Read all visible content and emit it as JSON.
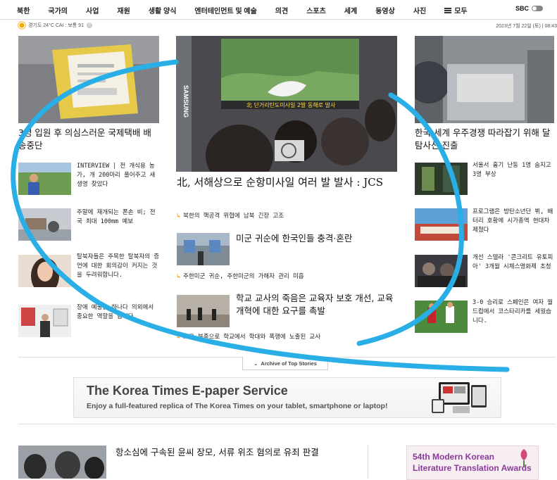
{
  "nav": {
    "items": [
      "북한",
      "국가의",
      "사업",
      "재원",
      "생활 양식",
      "엔터테인먼트 및 예술",
      "의견",
      "스포츠",
      "세계",
      "동영상",
      "사진"
    ],
    "all_label": "모두",
    "sbc_label": "SBC"
  },
  "weather": {
    "text": "경기도 24°C CAI : 보통 91",
    "icon": "sun-icon"
  },
  "date": "2023년 7월 22일 (토) | 08:43",
  "left": {
    "main_headline": "3명 입원 후 의심스러운 국제택배 배송중단",
    "items": [
      "INTERVIEW | 전 개식용 농가, 개 200마리 풀어주고 새 생명 찾았다",
      "주말에 재개되는 폰손 비; 전국 최대 100mm 예보",
      "탈북자들은 주목한 탈북자의 증언에 대한 회의감이 커지는 것을 두려워합니다.",
      "장애 예술을 하나다 의외에서 중요한 역할을 합니다."
    ]
  },
  "center": {
    "lead_headline": "北, 서해상으로 순항미사일 여러 발 발사 : JCS",
    "lead_sub": "북한의 핵공격 위협에 남북 긴장 고조",
    "story2_headline": "미군 귀순에 한국인들 충격·혼란",
    "story2_sub": "주한미군 귀순, 주한미군의 가해자 관리 미흡",
    "story3_headline": "학교 교사의 죽음은 교육자 보호 개선, 교육 개혁에 대한 요구를 촉발",
    "story3_sub": "교육 부족으로 학교에서 학대와 폭행에 노출된 교사",
    "tv_caption": "北 단거리탄도미사일 2발 동해로 발사",
    "samsung": "SAMSUNG"
  },
  "right": {
    "main_headline": "한국 세계 우주경쟁 따라잡기 위해 달 탐사선 진출",
    "items": [
      "서울서 흉기 난동 1명 숨지고 3명 부상",
      "프로그램은 방탄소년단 뷔, 배터리 호황에 시가총액 현대차 제쳤다",
      "개선 스텔라 '콘크리트 유토피아' 3개월 시체스영화제 초청",
      "3-0 승리로 스페인은 여자 월드컵에서 코스타리카를 세웠습니다."
    ]
  },
  "archive_label": "Archive of Top Stories",
  "epaper": {
    "title": "The Korea Times E-paper Service",
    "subtitle": "Enjoy a full-featured replica of The Korea Times on your tablet, smartphone or laptop!"
  },
  "bottom": {
    "headline": "항소심에 구속된 윤씨 장모, 서류 위조 혐의로 유죄 판결",
    "award_line1": "54th Modern Korean",
    "award_line2": "Literature Translation Awards"
  },
  "colors": {
    "annotation_stroke": "#29aee6",
    "accent": "#e08a00",
    "award": "#8a3a9a"
  }
}
